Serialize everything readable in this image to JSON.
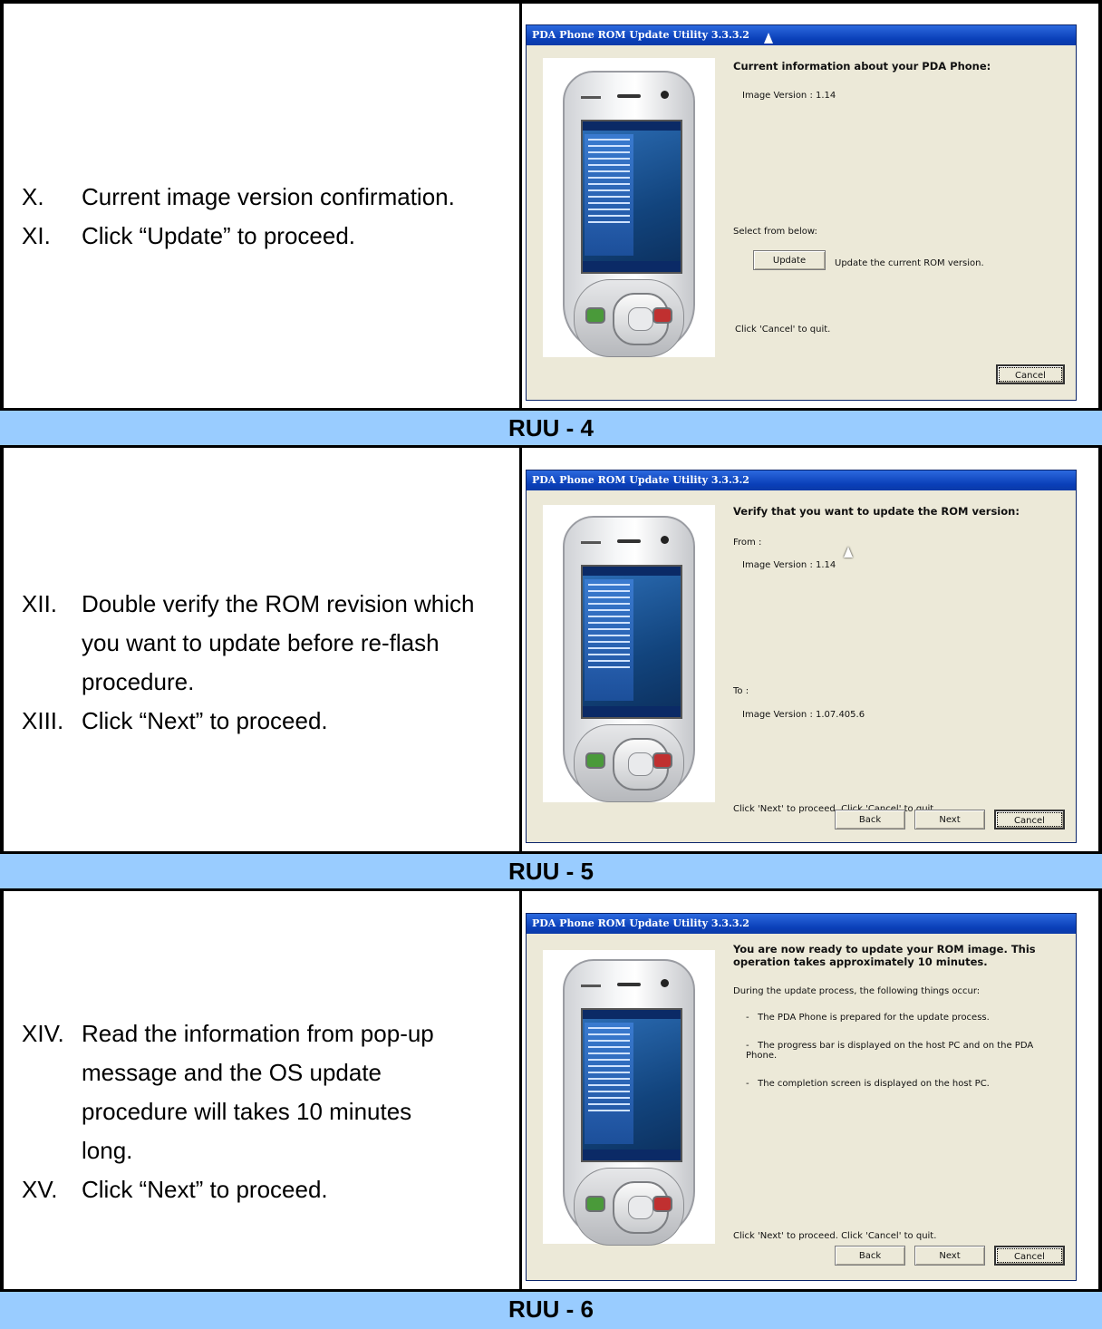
{
  "sections": [
    {
      "steps": [
        {
          "num": "X.",
          "text": "Current image version confirmation."
        },
        {
          "num": "XI.",
          "text": "Click “Update” to proceed."
        }
      ],
      "dialog": {
        "title": "PDA Phone ROM Update Utility 3.3.3.2",
        "heading": "Current information about your PDA Phone:",
        "image_version": "Image Version : 1.14",
        "select_label": "Select from below:",
        "update_button": "Update",
        "update_desc": "Update the current ROM version.",
        "cancel_hint": "Click 'Cancel' to quit.",
        "cancel_button": "Cancel"
      },
      "caption": "RUU - 4"
    },
    {
      "steps": [
        {
          "num": "XII.",
          "text": "Double verify the ROM revision which you want to update before re-flash procedure."
        },
        {
          "num": "XIII.",
          "text": "Click “Next” to proceed."
        }
      ],
      "dialog": {
        "title": "PDA Phone ROM Update Utility 3.3.3.2",
        "heading": "Verify that you want to update the ROM version:",
        "from_label": "From :",
        "from_version": "Image Version : 1.14",
        "to_label": "To :",
        "to_version": "Image Version : 1.07.405.6",
        "hint": "Click 'Next' to proceed. Click 'Cancel' to quit.",
        "back_button": "Back",
        "next_button": "Next",
        "cancel_button": "Cancel"
      },
      "caption": "RUU - 5"
    },
    {
      "steps": [
        {
          "num": "XIV.",
          "text": "Read the information from pop-up message and the OS update procedure will takes 10 minutes long."
        },
        {
          "num": "XV.",
          "text": "Click “Next” to proceed."
        }
      ],
      "dialog": {
        "title": "PDA Phone ROM Update Utility 3.3.3.2",
        "heading": "You are now ready to update your ROM image. This operation takes approximately 10 minutes.",
        "intro": "During the update process, the following things occur:",
        "bullets": [
          "The PDA Phone is prepared for the update process.",
          "The progress bar is displayed on the host PC and on the PDA Phone.",
          "The completion screen is displayed on the host PC."
        ],
        "hint": "Click 'Next' to proceed. Click 'Cancel' to quit.",
        "back_button": "Back",
        "next_button": "Next",
        "cancel_button": "Cancel"
      },
      "caption": "RUU - 6"
    }
  ]
}
